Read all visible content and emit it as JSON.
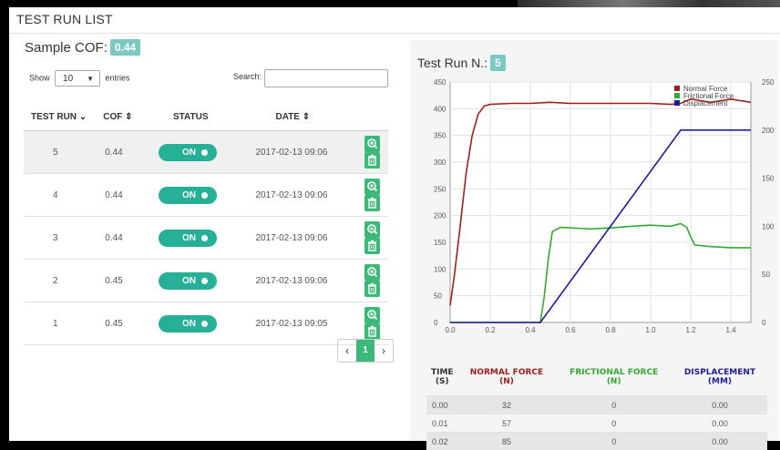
{
  "page_title": "TEST RUN LIST",
  "sample": {
    "label": "Sample COF:",
    "value": "0.44"
  },
  "length": {
    "show": "Show",
    "value": "10",
    "entries": "entries"
  },
  "search": {
    "label": "Search:",
    "placeholder": ""
  },
  "table": {
    "headers": [
      "TEST RUN",
      "COF",
      "STATUS",
      "DATE"
    ],
    "rows": [
      {
        "run": "5",
        "cof": "0.44",
        "status": "ON",
        "date": "2017-02-13 09:06"
      },
      {
        "run": "4",
        "cof": "0.44",
        "status": "ON",
        "date": "2017-02-13 09:06"
      },
      {
        "run": "3",
        "cof": "0.44",
        "status": "ON",
        "date": "2017-02-13 09:06"
      },
      {
        "run": "2",
        "cof": "0.45",
        "status": "ON",
        "date": "2017-02-13 09:06"
      },
      {
        "run": "1",
        "cof": "0.45",
        "status": "ON",
        "date": "2017-02-13 09:05"
      }
    ]
  },
  "pager": {
    "prev": "‹",
    "page": "1",
    "next": "›"
  },
  "detail": {
    "label": "Test Run N.:",
    "value": "5"
  },
  "colors": {
    "accent": "#26b097",
    "badge": "#7cc9c3",
    "normal": "#a0201c",
    "frictional": "#33aa33",
    "displacement": "#1d1d9a"
  },
  "chart_data": {
    "type": "line",
    "x_ticks": [
      "0.0",
      "0.2",
      "0.4",
      "0.6",
      "0.8",
      "1.0",
      "1.2",
      "1.4"
    ],
    "y_ticks": [
      "0",
      "50",
      "100",
      "150",
      "200",
      "250",
      "300",
      "350",
      "400",
      "450"
    ],
    "y2_ticks": [
      "0",
      "50",
      "100",
      "150",
      "200",
      "250"
    ],
    "xlim": [
      0,
      1.5
    ],
    "ylim": [
      0,
      450
    ],
    "y2lim": [
      0,
      250
    ],
    "grid": true,
    "legend": "top-right",
    "series": [
      {
        "name": "Normal Force",
        "axis": "left",
        "x": [
          0,
          0.02,
          0.05,
          0.08,
          0.11,
          0.14,
          0.17,
          0.2,
          0.3,
          0.4,
          0.5,
          0.6,
          0.7,
          0.8,
          0.9,
          1.0,
          1.1,
          1.15,
          1.2,
          1.3,
          1.4,
          1.5
        ],
        "y": [
          32,
          85,
          180,
          280,
          350,
          390,
          405,
          408,
          410,
          410,
          412,
          410,
          410,
          410,
          410,
          410,
          408,
          410,
          418,
          412,
          418,
          412
        ]
      },
      {
        "name": "Frictional Force",
        "axis": "left",
        "x": [
          0,
          0.45,
          0.47,
          0.49,
          0.51,
          0.55,
          0.7,
          0.8,
          0.9,
          1.0,
          1.1,
          1.15,
          1.18,
          1.2,
          1.22,
          1.3,
          1.4,
          1.5
        ],
        "y": [
          0,
          0,
          50,
          120,
          170,
          178,
          175,
          177,
          180,
          182,
          180,
          185,
          178,
          160,
          145,
          142,
          140,
          140
        ]
      },
      {
        "name": "Displacement",
        "axis": "right",
        "x": [
          0,
          0.45,
          1.15,
          1.2,
          1.5
        ],
        "y": [
          0,
          0,
          200,
          200,
          200
        ]
      }
    ]
  },
  "data_table": {
    "headers": [
      {
        "top": "TIME",
        "bottom": "(S)"
      },
      {
        "top": "NORMAL FORCE",
        "bottom": "(N)"
      },
      {
        "top": "FRICTIONAL FORCE",
        "bottom": "(N)"
      },
      {
        "top": "DISPLACEMENT",
        "bottom": "(MM)"
      }
    ],
    "rows": [
      [
        "0.00",
        "32",
        "0",
        "0.00"
      ],
      [
        "0.01",
        "57",
        "0",
        "0.00"
      ],
      [
        "0.02",
        "85",
        "0",
        "0.00"
      ]
    ]
  }
}
